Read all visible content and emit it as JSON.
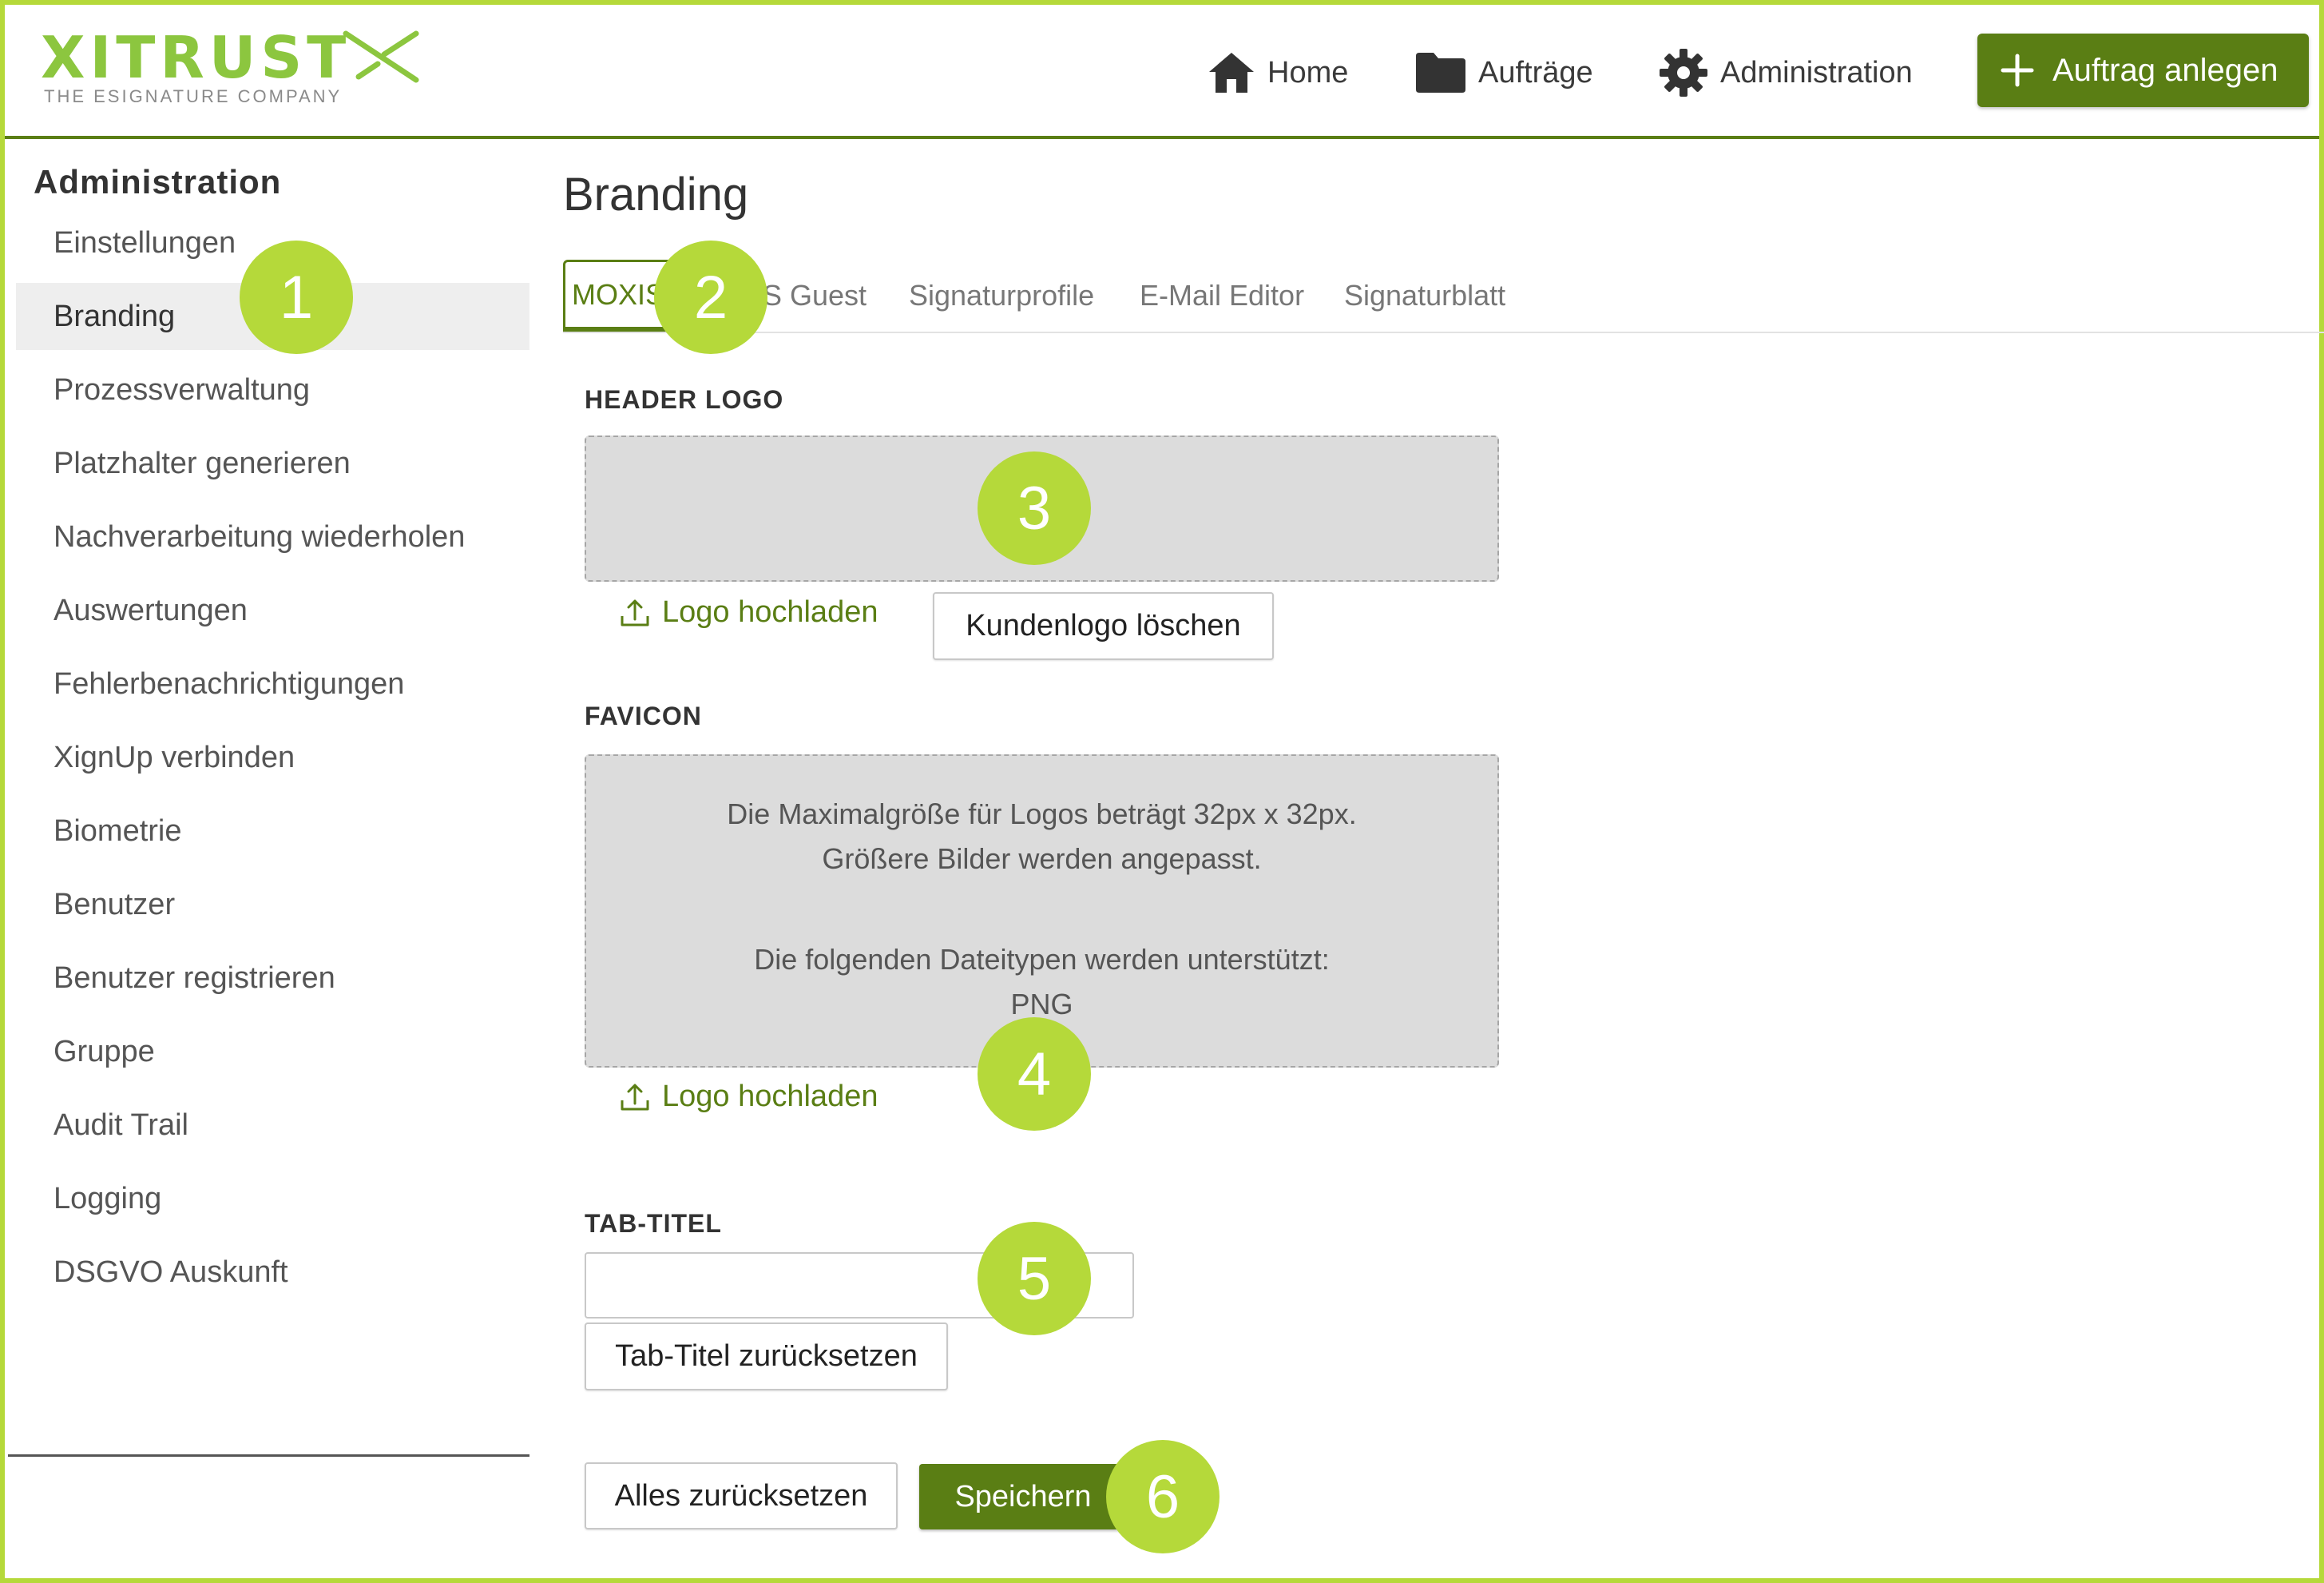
{
  "header": {
    "logo_text": "XITRUST",
    "logo_subtitle": "THE ESIGNATURE COMPANY",
    "nav": {
      "home": "Home",
      "auftraege": "Aufträge",
      "administration": "Administration"
    },
    "new_order_button": "Auftrag anlegen"
  },
  "sidebar": {
    "title": "Administration",
    "items": [
      {
        "label": "Einstellungen"
      },
      {
        "label": "Branding"
      },
      {
        "label": "Prozessverwaltung"
      },
      {
        "label": "Platzhalter generieren"
      },
      {
        "label": "Nachverarbeitung wiederholen"
      },
      {
        "label": "Auswertungen"
      },
      {
        "label": "Fehlerbenachrichtigungen"
      },
      {
        "label": "XignUp verbinden"
      },
      {
        "label": "Biometrie"
      },
      {
        "label": "Benutzer"
      },
      {
        "label": "Benutzer registrieren"
      },
      {
        "label": "Gruppe"
      },
      {
        "label": "Audit Trail"
      },
      {
        "label": "Logging"
      },
      {
        "label": "DSGVO Auskunft"
      }
    ],
    "active_item": "Branding"
  },
  "main": {
    "title": "Branding",
    "tabs": [
      {
        "label": "MOXIS"
      },
      {
        "label": "S Guest"
      },
      {
        "label": "Signaturprofile"
      },
      {
        "label": "E-Mail Editor"
      },
      {
        "label": "Signaturblatt"
      }
    ],
    "header_logo": {
      "label": "HEADER LOGO",
      "upload_label": "Logo hochladen",
      "delete_button": "Kundenlogo löschen"
    },
    "favicon": {
      "label": "FAVICON",
      "hint_line1": "Die Maximalgröße für Logos beträgt 32px x 32px.",
      "hint_line2": "Größere Bilder werden angepasst.",
      "hint_line3": "Die folgenden Dateitypen werden unterstützt:",
      "hint_line4": "PNG",
      "upload_label": "Logo hochladen"
    },
    "tab_title": {
      "label": "TAB-TITEL",
      "value": "",
      "reset_button": "Tab-Titel zurücksetzen"
    },
    "reset_all_button": "Alles zurücksetzen",
    "save_button": "Speichern"
  },
  "markers": [
    "1",
    "2",
    "3",
    "4",
    "5",
    "6"
  ],
  "colors": {
    "brand_green": "#5a7e14",
    "accent_lime": "#b5d93a",
    "logo_green": "#8cc63f"
  }
}
